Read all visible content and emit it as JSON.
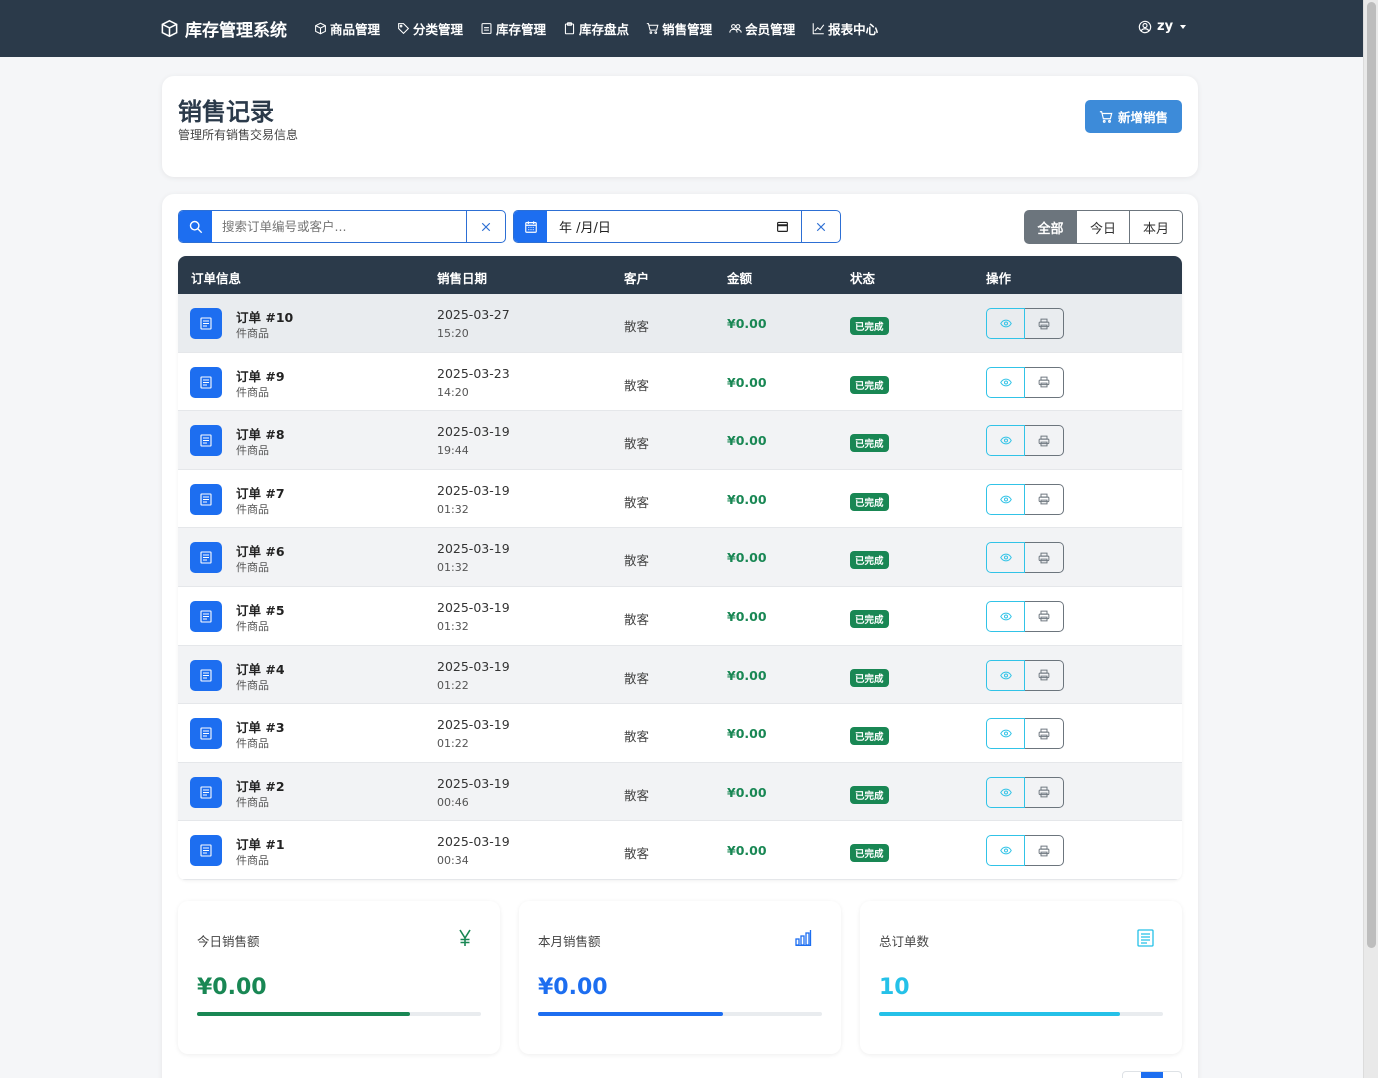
{
  "nav": {
    "brand": "库存管理系统",
    "items": [
      {
        "label": "商品管理",
        "icon": "box-icon"
      },
      {
        "label": "分类管理",
        "icon": "tag-icon"
      },
      {
        "label": "库存管理",
        "icon": "inventory-icon"
      },
      {
        "label": "库存盘点",
        "icon": "clipboard-icon"
      },
      {
        "label": "销售管理",
        "icon": "cart-icon"
      },
      {
        "label": "会员管理",
        "icon": "people-icon"
      },
      {
        "label": "报表中心",
        "icon": "chart-line-icon"
      }
    ],
    "user": "zy"
  },
  "header": {
    "title": "销售记录",
    "subtitle": "管理所有销售交易信息",
    "new_button": "新增销售"
  },
  "filters": {
    "search_placeholder": "搜索订单编号或客户...",
    "date_value": "年 /月/日",
    "buttons": [
      "全部",
      "今日",
      "本月"
    ],
    "active": "全部"
  },
  "table": {
    "columns": [
      "订单信息",
      "销售日期",
      "客户",
      "金额",
      "状态",
      "操作"
    ],
    "rows": [
      {
        "order": "订单 #10",
        "items": "件商品",
        "date": "2025-03-27",
        "time": "15:20",
        "customer": "散客",
        "amount": "¥0.00",
        "status": "已完成"
      },
      {
        "order": "订单 #9",
        "items": "件商品",
        "date": "2025-03-23",
        "time": "14:20",
        "customer": "散客",
        "amount": "¥0.00",
        "status": "已完成"
      },
      {
        "order": "订单 #8",
        "items": "件商品",
        "date": "2025-03-19",
        "time": "19:44",
        "customer": "散客",
        "amount": "¥0.00",
        "status": "已完成"
      },
      {
        "order": "订单 #7",
        "items": "件商品",
        "date": "2025-03-19",
        "time": "01:32",
        "customer": "散客",
        "amount": "¥0.00",
        "status": "已完成"
      },
      {
        "order": "订单 #6",
        "items": "件商品",
        "date": "2025-03-19",
        "time": "01:32",
        "customer": "散客",
        "amount": "¥0.00",
        "status": "已完成"
      },
      {
        "order": "订单 #5",
        "items": "件商品",
        "date": "2025-03-19",
        "time": "01:32",
        "customer": "散客",
        "amount": "¥0.00",
        "status": "已完成"
      },
      {
        "order": "订单 #4",
        "items": "件商品",
        "date": "2025-03-19",
        "time": "01:22",
        "customer": "散客",
        "amount": "¥0.00",
        "status": "已完成"
      },
      {
        "order": "订单 #3",
        "items": "件商品",
        "date": "2025-03-19",
        "time": "01:22",
        "customer": "散客",
        "amount": "¥0.00",
        "status": "已完成"
      },
      {
        "order": "订单 #2",
        "items": "件商品",
        "date": "2025-03-19",
        "time": "00:46",
        "customer": "散客",
        "amount": "¥0.00",
        "status": "已完成"
      },
      {
        "order": "订单 #1",
        "items": "件商品",
        "date": "2025-03-19",
        "time": "00:34",
        "customer": "散客",
        "amount": "¥0.00",
        "status": "已完成"
      }
    ]
  },
  "stats": [
    {
      "label": "今日销售额",
      "value": "¥0.00",
      "icon": "yen-icon",
      "color": "#198754",
      "progress": 0.75
    },
    {
      "label": "本月销售额",
      "value": "¥0.00",
      "icon": "bar-chart-icon",
      "color": "#1d6ef0",
      "progress": 0.65
    },
    {
      "label": "总订单数",
      "value": "10",
      "icon": "receipt-icon",
      "color": "#25c1e8",
      "progress": 0.85
    }
  ],
  "colors": {
    "navbar": "#2b3a4a",
    "primary": "#1d6ef0",
    "success": "#198754",
    "info": "#25c1e8",
    "secondary": "#6c757d"
  }
}
